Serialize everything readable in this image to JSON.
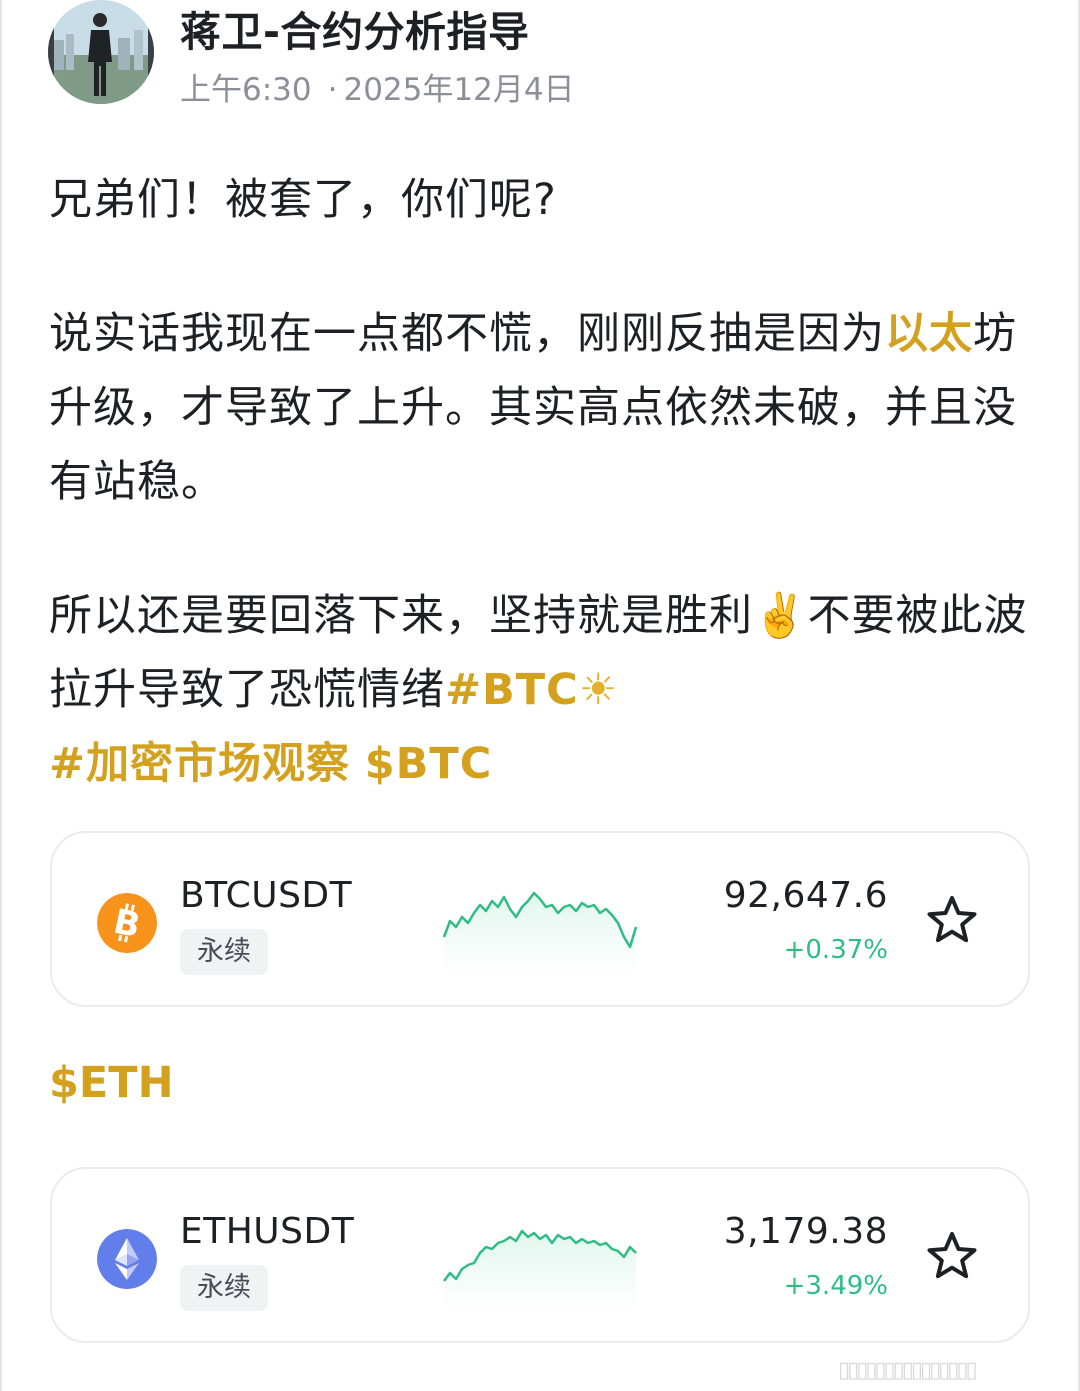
{
  "post": {
    "author": "蒋卫-合约分析指导",
    "time": "上午6:30",
    "date": "2025年12月4日",
    "paragraphs": {
      "p1": "兄弟们！被套了，你们呢?",
      "p2_a": "说实话我现在一点都不慌，刚刚反抽是因为",
      "p2_highlight": "以太",
      "p2_b": "坊升级，才导致了上升。其实高点依然未破，并且没有站稳。",
      "p3_a": "所以还是要回落下来，坚持就是胜利",
      "p3_emoji": "✌️",
      "p3_b": "不要被此波拉升导致了恐慌情绪",
      "p3_tag_btc": "#BTC",
      "p3_sun": "☀",
      "p3_tag_market": "#加密市场观察",
      "p3_cashtag_btc": "$BTC"
    },
    "cashtag_eth": "$ETH"
  },
  "cards": [
    {
      "symbol": "BTCUSDT",
      "badge": "永续",
      "price": "92,647.6",
      "change": "+0.37%",
      "icon": "bitcoin-icon",
      "icon_color": "#f7931a",
      "spark_color": "#2ebd85"
    },
    {
      "symbol": "ETHUSDT",
      "badge": "永续",
      "price": "3,179.38",
      "change": "+3.49%",
      "icon": "ethereum-icon",
      "icon_color": "#627eea",
      "spark_color": "#2ebd85"
    }
  ],
  "colors": {
    "accent_gold": "#d4a11e",
    "positive_green": "#2ebd85",
    "text_primary": "#1e2026",
    "text_secondary": "#8a8f98"
  },
  "icons": [
    "star-outline-icon",
    "bitcoin-icon",
    "ethereum-icon",
    "avatar-photo"
  ]
}
